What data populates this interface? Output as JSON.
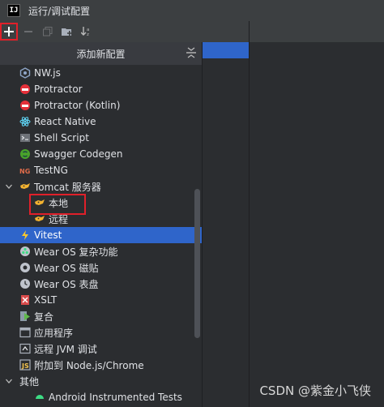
{
  "window": {
    "title": "运行/调试配置",
    "app_icon_text": "IJ"
  },
  "popup": {
    "header": "添加新配置",
    "items": [
      {
        "label": "NW.js",
        "icon": "nwjs-icon"
      },
      {
        "label": "Protractor",
        "icon": "protractor-icon"
      },
      {
        "label": "Protractor (Kotlin)",
        "icon": "protractor-icon"
      },
      {
        "label": "React Native",
        "icon": "react-icon"
      },
      {
        "label": "Shell Script",
        "icon": "shell-icon"
      },
      {
        "label": "Swagger Codegen",
        "icon": "swagger-icon"
      },
      {
        "label": "TestNG",
        "icon": "testng-icon"
      },
      {
        "label": "Tomcat 服务器",
        "icon": "tomcat-icon"
      },
      {
        "label": "本地",
        "icon": "tomcat-icon"
      },
      {
        "label": "远程",
        "icon": "tomcat-icon"
      },
      {
        "label": "Vitest",
        "icon": "vitest-icon"
      },
      {
        "label": "Wear OS 复杂功能",
        "icon": "wearos-icon"
      },
      {
        "label": "Wear OS 磁贴",
        "icon": "wearos-icon"
      },
      {
        "label": "Wear OS 表盘",
        "icon": "wearos-icon"
      },
      {
        "label": "XSLT",
        "icon": "xslt-icon"
      },
      {
        "label": "复合",
        "icon": "compound-icon"
      },
      {
        "label": "应用程序",
        "icon": "application-icon"
      },
      {
        "label": "远程 JVM 调试",
        "icon": "remote-debug-icon"
      },
      {
        "label": "附加到 Node.js/Chrome",
        "icon": "node-attach-icon"
      },
      {
        "label": "其他",
        "icon": "chevron-down-icon"
      },
      {
        "label": "Android Instrumented Tests",
        "icon": "android-icon"
      }
    ]
  },
  "colors": {
    "selection": "#2f65ca",
    "highlight_box": "#e0202a"
  },
  "watermark": "CSDN @紫金小飞侠"
}
